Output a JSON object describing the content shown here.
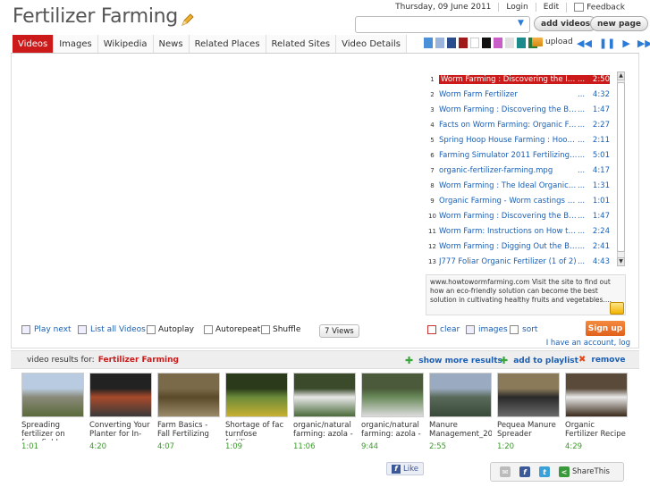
{
  "header": {
    "title": "Fertilizer Farming",
    "date": "Thursday, 09 June 2011",
    "login": "Login",
    "edit": "Edit",
    "feedback": "Feedback",
    "search_value": "",
    "add_videos": "add videos",
    "new_page": "new page"
  },
  "tabs": [
    {
      "label": "Videos",
      "active": true
    },
    {
      "label": "Images"
    },
    {
      "label": "Wikipedia"
    },
    {
      "label": "News"
    },
    {
      "label": "Related Places"
    },
    {
      "label": "Related Sites"
    },
    {
      "label": "Video Details"
    }
  ],
  "swatches": [
    "#4a90d9",
    "#9ab4dc",
    "#2a4e8c",
    "#a01818",
    "#ffffff",
    "#111111",
    "#c95ec9",
    "#e0e0e0",
    "#1a8a8a",
    "#2a7a3a"
  ],
  "toolbar": {
    "upload": "upload"
  },
  "playlist": [
    {
      "num": "1",
      "title": "Worm Farming : Discovering the Ideal C...",
      "dur": "2:50"
    },
    {
      "num": "2",
      "title": "Worm Farm Fertilizer",
      "dur": "4:32"
    },
    {
      "num": "3",
      "title": "Worm Farming : Discovering the Best Ou...",
      "dur": "1:47"
    },
    {
      "num": "4",
      "title": "Facts on Worm Farming: Organic Fertiliz...",
      "dur": "2:27"
    },
    {
      "num": "5",
      "title": "Spring Hoop House Farming : Hoop Ho...",
      "dur": "2:11"
    },
    {
      "num": "6",
      "title": "Farming Simulator 2011 Fertilizing with r...",
      "dur": "5:01"
    },
    {
      "num": "7",
      "title": "organic-fertilizer-farming.mpg",
      "dur": "4:17"
    },
    {
      "num": "8",
      "title": "Worm Farming : The Ideal Organic Fertil...",
      "dur": "1:31"
    },
    {
      "num": "9",
      "title": "Organic Farming - Worm castings for fer...",
      "dur": "1:01"
    },
    {
      "num": "10",
      "title": "Worm Farming : Discovering the Best Ou...",
      "dur": "1:47"
    },
    {
      "num": "11",
      "title": "Worm Farm: Instructions on How to Mak...",
      "dur": "2:24"
    },
    {
      "num": "12",
      "title": "Worm Farming : Digging Out the Best Ou...",
      "dur": "2:41"
    },
    {
      "num": "13",
      "title": "J777 Foliar Organic Fertilizer (1 of 2)",
      "dur": "4:43"
    }
  ],
  "description": "www.howtowormfarming.com Visit the site to find out how an eco-friendly solution can become the best solution in cultivating healthy fruits and vegetables....",
  "controls": {
    "play_next": "Play next",
    "list_all": "List all Videos",
    "autoplay": "Autoplay",
    "autorepeat": "Autorepeat",
    "shuffle": "Shuffle",
    "views": "7 Views",
    "clear": "clear",
    "images": "images",
    "sort": "sort",
    "signup": "Sign up",
    "have_account": "I have an account, log"
  },
  "results": {
    "label": "video results for:",
    "query": "Fertilizer Farming",
    "show_more": "show more results",
    "add_playlist": "add to playlist",
    "remove": "remove"
  },
  "thumbs": [
    {
      "title": "Spreading fertilizer on farm fields",
      "dur": "1:01",
      "colors": [
        "#b9cbe0",
        "#8a8a7a",
        "#5a6a3a"
      ]
    },
    {
      "title": "Converting Your Planter for In-",
      "dur": "4:20",
      "colors": [
        "#222222",
        "#a84a2a",
        "#3a3a3a"
      ]
    },
    {
      "title": "Farm Basics - Fall Fertilizing",
      "dur": "4:07",
      "colors": [
        "#7a6a4a",
        "#5a4a2a",
        "#9a8a6a"
      ]
    },
    {
      "title": "Shortage of fac turnfose fertilizer",
      "dur": "1:09",
      "colors": [
        "#2a3a1a",
        "#6a8a3a",
        "#c8b030"
      ]
    },
    {
      "title": "organic/natural farming: azola -",
      "dur": "11:06",
      "colors": [
        "#3a4a2a",
        "#e8e8e8",
        "#4a6a3a"
      ]
    },
    {
      "title": "organic/natural farming: azola -",
      "dur": "9:44",
      "colors": [
        "#4a5a3a",
        "#6a8a5a",
        "#dcdcdc"
      ]
    },
    {
      "title": "Manure Management_2010.wmv",
      "dur": "2:55",
      "colors": [
        "#9aaac0",
        "#5a6a5a",
        "#3a4a3a"
      ]
    },
    {
      "title": "Pequea Manure Spreader",
      "dur": "1:20",
      "colors": [
        "#8a7a5a",
        "#2a2a2a",
        "#6a6a6a"
      ]
    },
    {
      "title": "Organic Fertilizer Recipe",
      "dur": "4:29",
      "colors": [
        "#5a4a3a",
        "#eaeaea",
        "#3a2a1a"
      ]
    }
  ],
  "social": {
    "like": "Like",
    "sharethis": "ShareThis"
  }
}
